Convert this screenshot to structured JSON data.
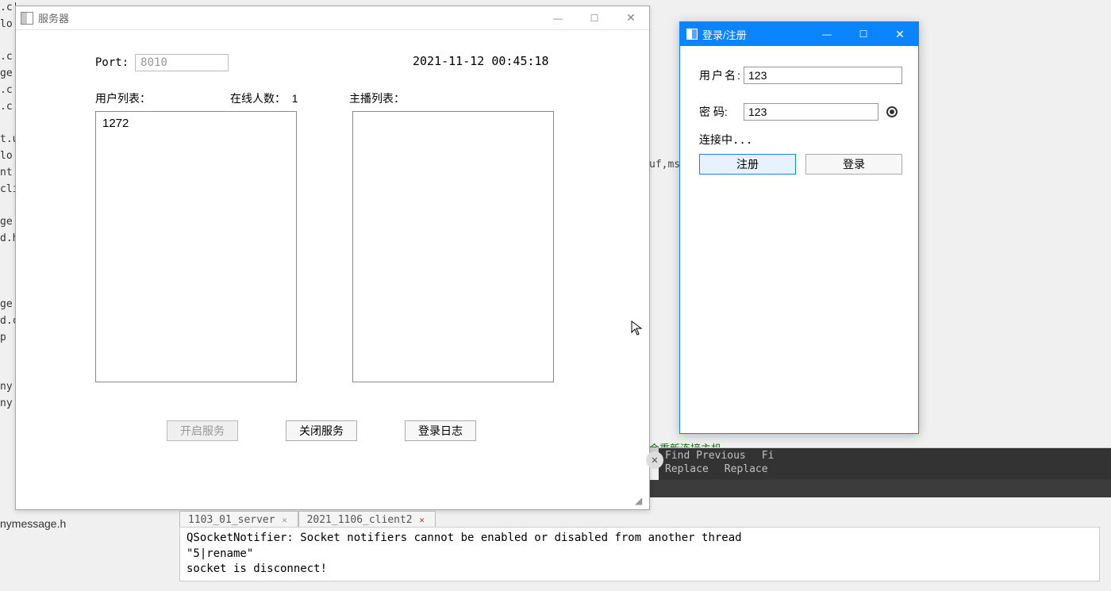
{
  "bg": {
    "frag_lines": ".c|\nlo\n\n.c|\nge\n.c\n.c\n\nt.u\nlo\nnt\ncli\n\nge\nd.h\n\n\n\nge\nd.c\np\n\n\nny\nny\n",
    "right_frag": "uf,ms",
    "green_frag": "会重新连接主机",
    "file_h": "nymessage.h"
  },
  "server": {
    "title": "服务器",
    "port_label": "Port:",
    "port_value": "8010",
    "timestamp": "2021-11-12 00:45:18",
    "user_list_label": "用户列表：",
    "online_label": "在线人数：",
    "online_value": "1",
    "host_list_label": "主播列表：",
    "user_items": [
      "1272"
    ],
    "btn_start": "开启服务",
    "btn_stop": "关闭服务",
    "btn_log": "登录日志"
  },
  "login": {
    "title": "登录/注册",
    "user_label": "用户名:",
    "user_value": "123",
    "pwd_label": "密  码:",
    "pwd_value": "123",
    "status": "连接中...",
    "btn_register": "注册",
    "btn_login": "登录"
  },
  "findbar": {
    "find_prev": "Find Previous",
    "find_right": "Fi",
    "replace": "Replace",
    "replace_right": "Replace "
  },
  "tabs": {
    "t1": "1103_01_server",
    "t2": "2021_1106_client2"
  },
  "console": {
    "line1": "QSocketNotifier: Socket notifiers cannot be enabled or disabled from another thread",
    "line2": "\"5|rename\"",
    "line3": "socket is disconnect!"
  }
}
